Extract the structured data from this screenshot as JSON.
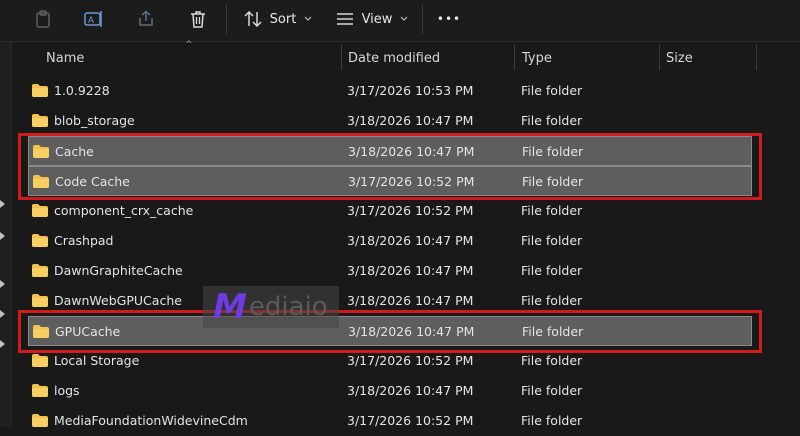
{
  "toolbar": {
    "sort_label": "Sort",
    "view_label": "View",
    "more_label": "•••"
  },
  "columns": {
    "name": "Name",
    "date": "Date modified",
    "type": "Type",
    "size": "Size"
  },
  "rows": [
    {
      "name": "1.0.9228",
      "date": "3/17/2026 10:53 PM",
      "type": "File folder",
      "selected": false
    },
    {
      "name": "blob_storage",
      "date": "3/18/2026 10:47 PM",
      "type": "File folder",
      "selected": false
    },
    {
      "name": "Cache",
      "date": "3/18/2026 10:47 PM",
      "type": "File folder",
      "selected": true
    },
    {
      "name": "Code Cache",
      "date": "3/17/2026 10:52 PM",
      "type": "File folder",
      "selected": true
    },
    {
      "name": "component_crx_cache",
      "date": "3/17/2026 10:52 PM",
      "type": "File folder",
      "selected": false
    },
    {
      "name": "Crashpad",
      "date": "3/18/2026 10:47 PM",
      "type": "File folder",
      "selected": false
    },
    {
      "name": "DawnGraphiteCache",
      "date": "3/18/2026 10:47 PM",
      "type": "File folder",
      "selected": false
    },
    {
      "name": "DawnWebGPUCache",
      "date": "3/18/2026 10:47 PM",
      "type": "File folder",
      "selected": false
    },
    {
      "name": "GPUCache",
      "date": "3/18/2026 10:47 PM",
      "type": "File folder",
      "selected": true
    },
    {
      "name": "Local Storage",
      "date": "3/17/2026 10:52 PM",
      "type": "File folder",
      "selected": false
    },
    {
      "name": "logs",
      "date": "3/18/2026 10:47 PM",
      "type": "File folder",
      "selected": false
    },
    {
      "name": "MediaFoundationWidevineCdm",
      "date": "3/17/2026 10:52 PM",
      "type": "File folder",
      "selected": false
    }
  ],
  "watermark": {
    "mark": "M",
    "text": "ediaio"
  },
  "colors": {
    "background": "#191919",
    "selection": "#5e5e5e",
    "highlight": "#d11a1a",
    "folder": "#f2c14e"
  }
}
